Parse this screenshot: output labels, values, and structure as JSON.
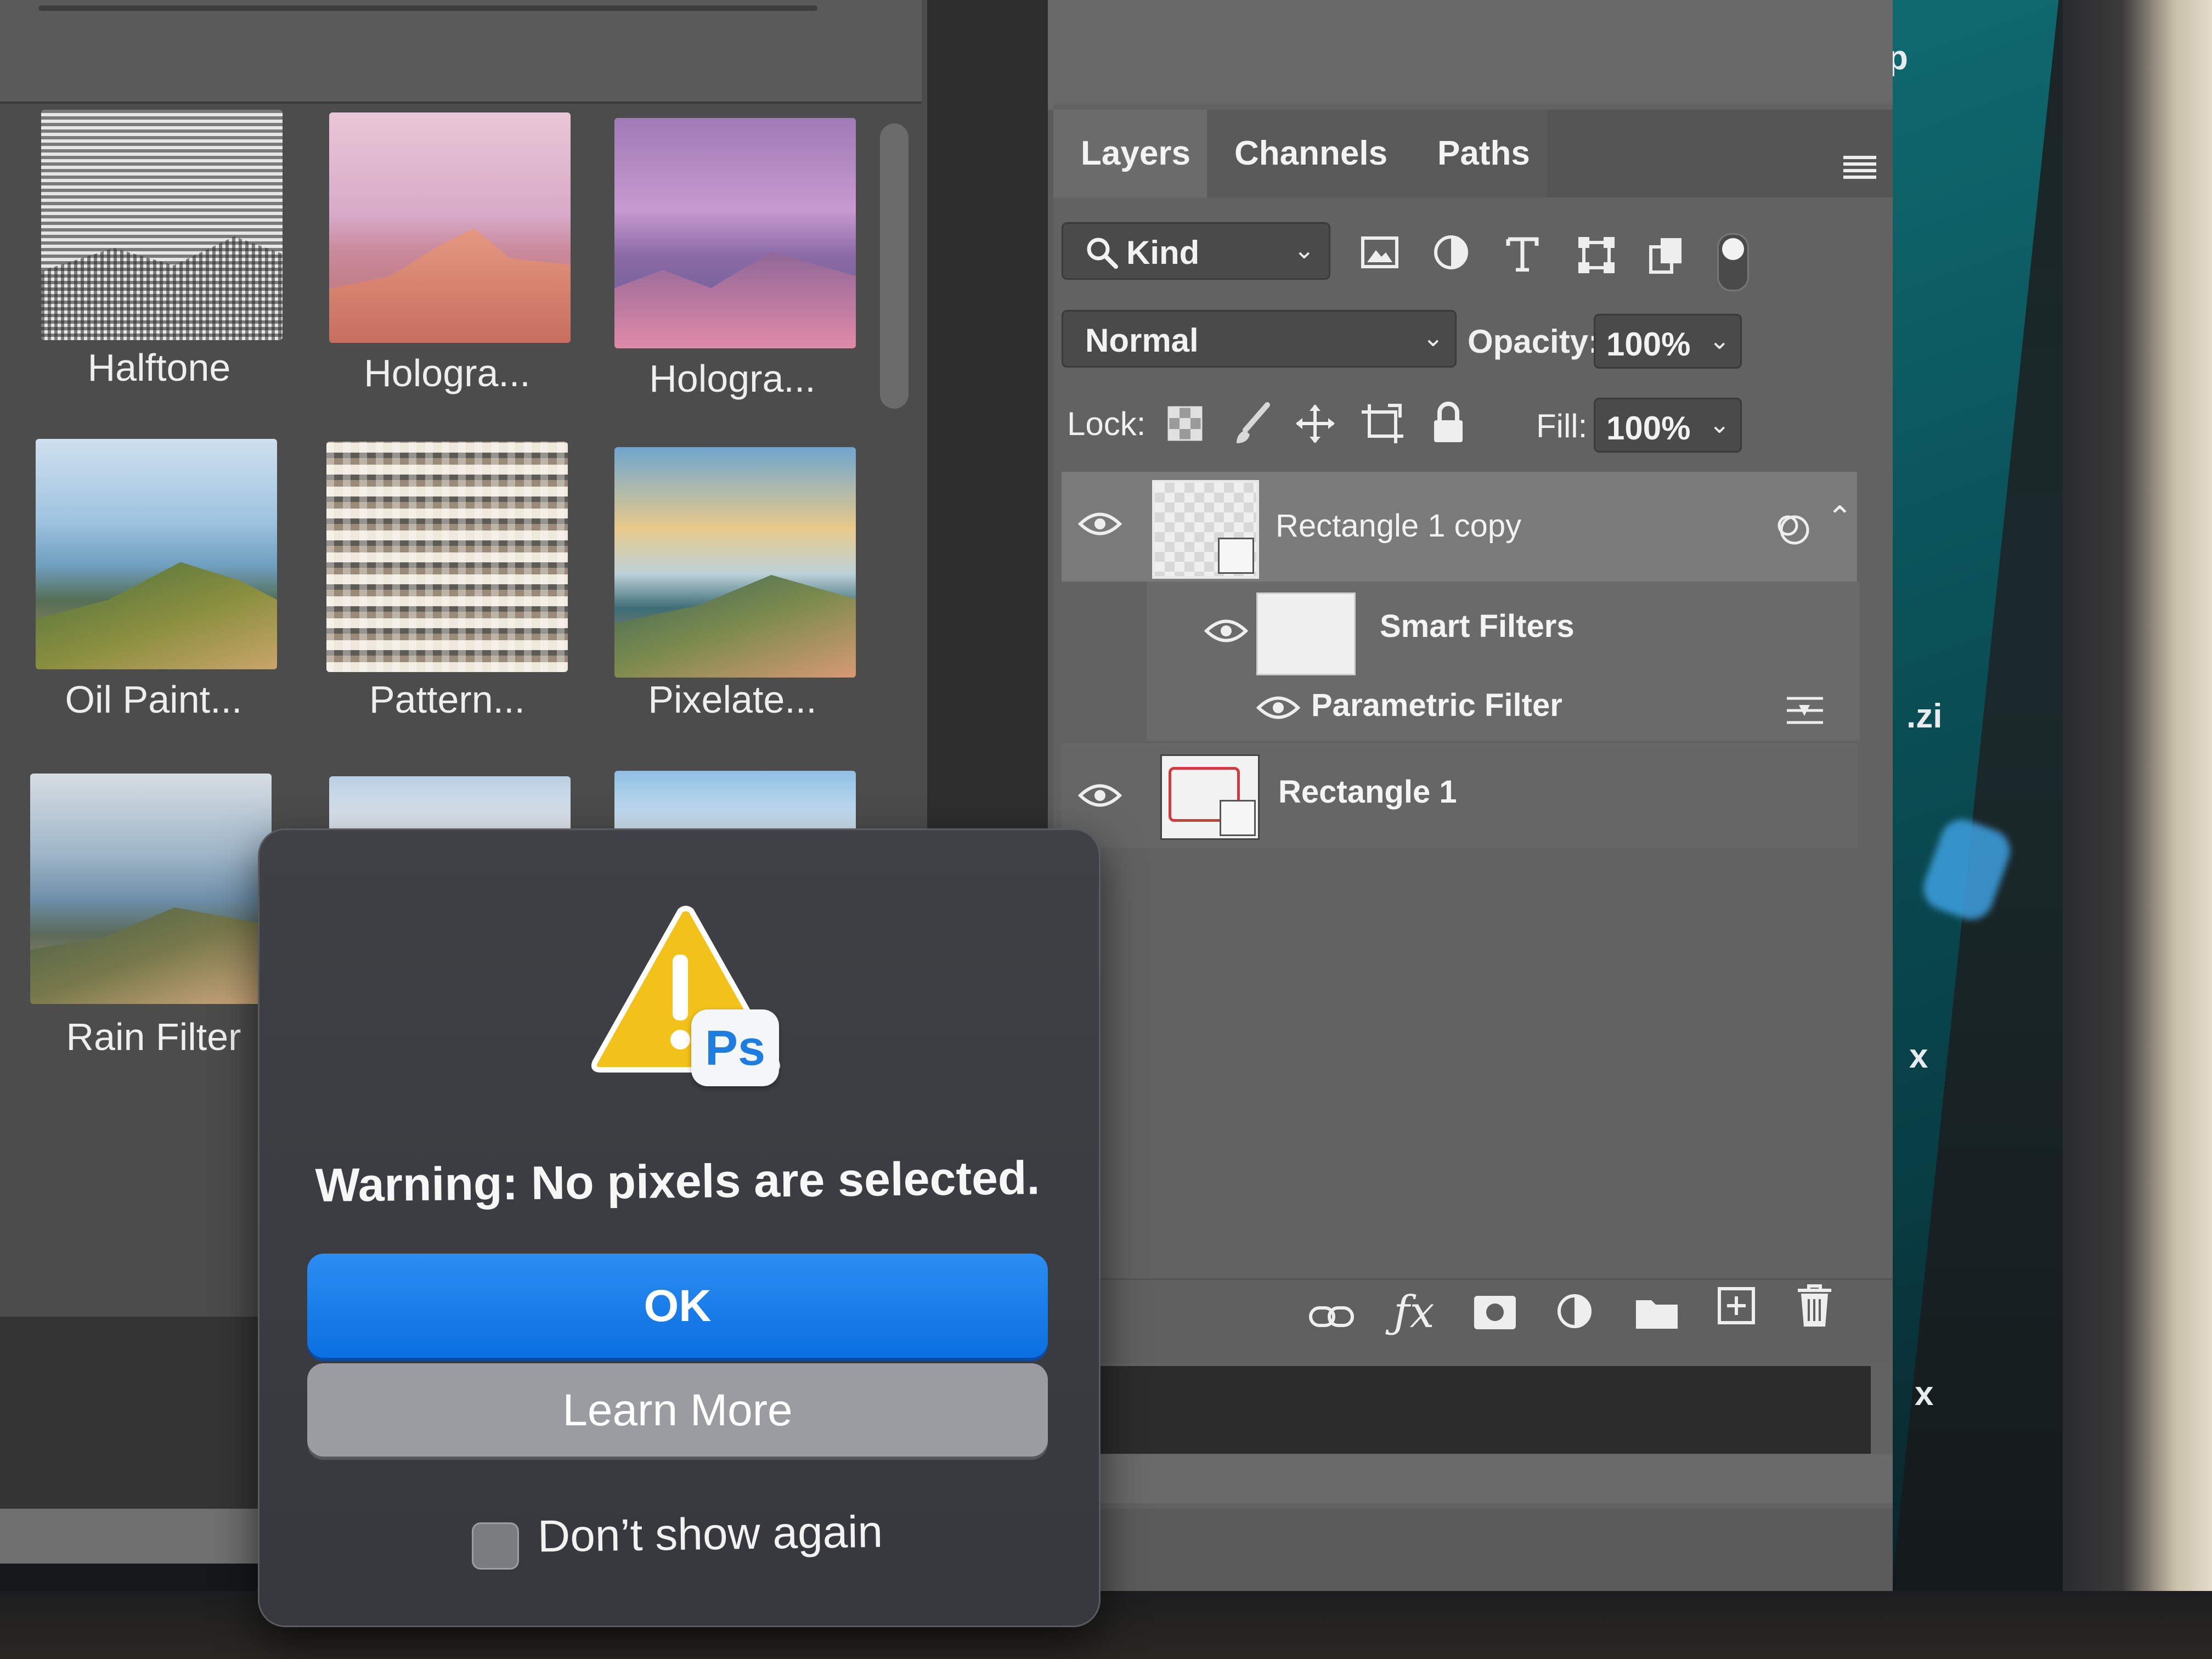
{
  "gallery": {
    "items": [
      {
        "label": "Halftone"
      },
      {
        "label": "Hologra..."
      },
      {
        "label": "Hologra..."
      },
      {
        "label": "Oil Paint..."
      },
      {
        "label": "Pattern..."
      },
      {
        "label": "Pixelate..."
      },
      {
        "label": "Rain Filter"
      }
    ]
  },
  "layers_panel": {
    "tabs": [
      {
        "label": "Layers"
      },
      {
        "label": "Channels"
      },
      {
        "label": "Paths"
      }
    ],
    "filter_kind": "Kind",
    "blend_mode": "Normal",
    "opacity_label": "Opacity:",
    "opacity_value": "100%",
    "lock_label": "Lock:",
    "fill_label": "Fill:",
    "fill_value": "100%",
    "layers": [
      {
        "name": "Rectangle 1 copy"
      },
      {
        "name": "Smart Filters"
      },
      {
        "name": "Parametric Filter"
      },
      {
        "name": "Rectangle 1"
      }
    ]
  },
  "desktop": {
    "labels": [
      "p",
      ".zi",
      "x",
      "x"
    ]
  },
  "dialog": {
    "badge": "Ps",
    "message": "Warning: No pixels are selected.",
    "ok_label": "OK",
    "learn_label": "Learn More",
    "dont_show_label": "Don’t show again"
  },
  "colors": {
    "ok_button": "#0a6fe0",
    "warning_yellow": "#f2c21a",
    "ps_blue": "#1f7de0",
    "panel_gray": "#5b5b5b"
  }
}
